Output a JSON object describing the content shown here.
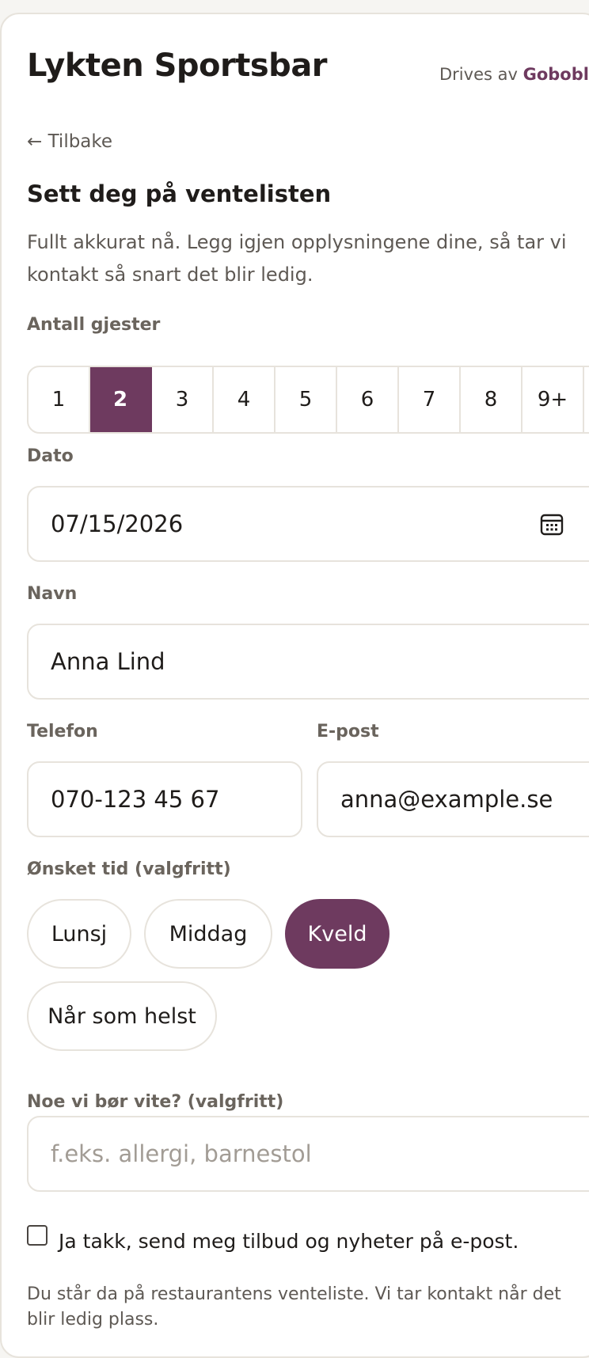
{
  "header": {
    "title": "Lykten Sportsbar",
    "powered_prefix": "Drives av",
    "powered_brand": "Goboblo"
  },
  "nav": {
    "back_label": "← Tilbake"
  },
  "form": {
    "heading": "Sett deg på ventelisten",
    "intro": "Fullt akkurat nå. Legg igjen opplysningene dine, så tar vi kontakt så snart det blir ledig.",
    "guests": {
      "label": "Antall gjester",
      "options": [
        "1",
        "2",
        "3",
        "4",
        "5",
        "6",
        "7",
        "8",
        "9+"
      ],
      "selected": "2"
    },
    "date": {
      "label": "Dato",
      "value": "07/15/2026",
      "icon": "calendar-icon"
    },
    "name": {
      "label": "Navn",
      "value": "Anna Lind"
    },
    "phone": {
      "label": "Telefon",
      "value": "070-123 45 67"
    },
    "email": {
      "label": "E-post",
      "value": "anna@example.se"
    },
    "time": {
      "label": "Ønsket tid (valgfritt)",
      "options": [
        "Lunsj",
        "Middag",
        "Kveld",
        "Når som helst"
      ],
      "selected": "Kveld"
    },
    "notes": {
      "label": "Noe vi bør vite? (valgfritt)",
      "value": "",
      "placeholder": "f.eks. allergi, barnestol"
    },
    "newsletter": {
      "label": "Ja takk, send meg tilbud og nyheter på e-post.",
      "checked": false
    },
    "footer_note": "Du står da på restaurantens venteliste. Vi tar kontakt når det blir ledig plass."
  },
  "colors": {
    "accent": "#6e3a5f",
    "border": "#e7e3dc",
    "muted": "#5e5954"
  }
}
